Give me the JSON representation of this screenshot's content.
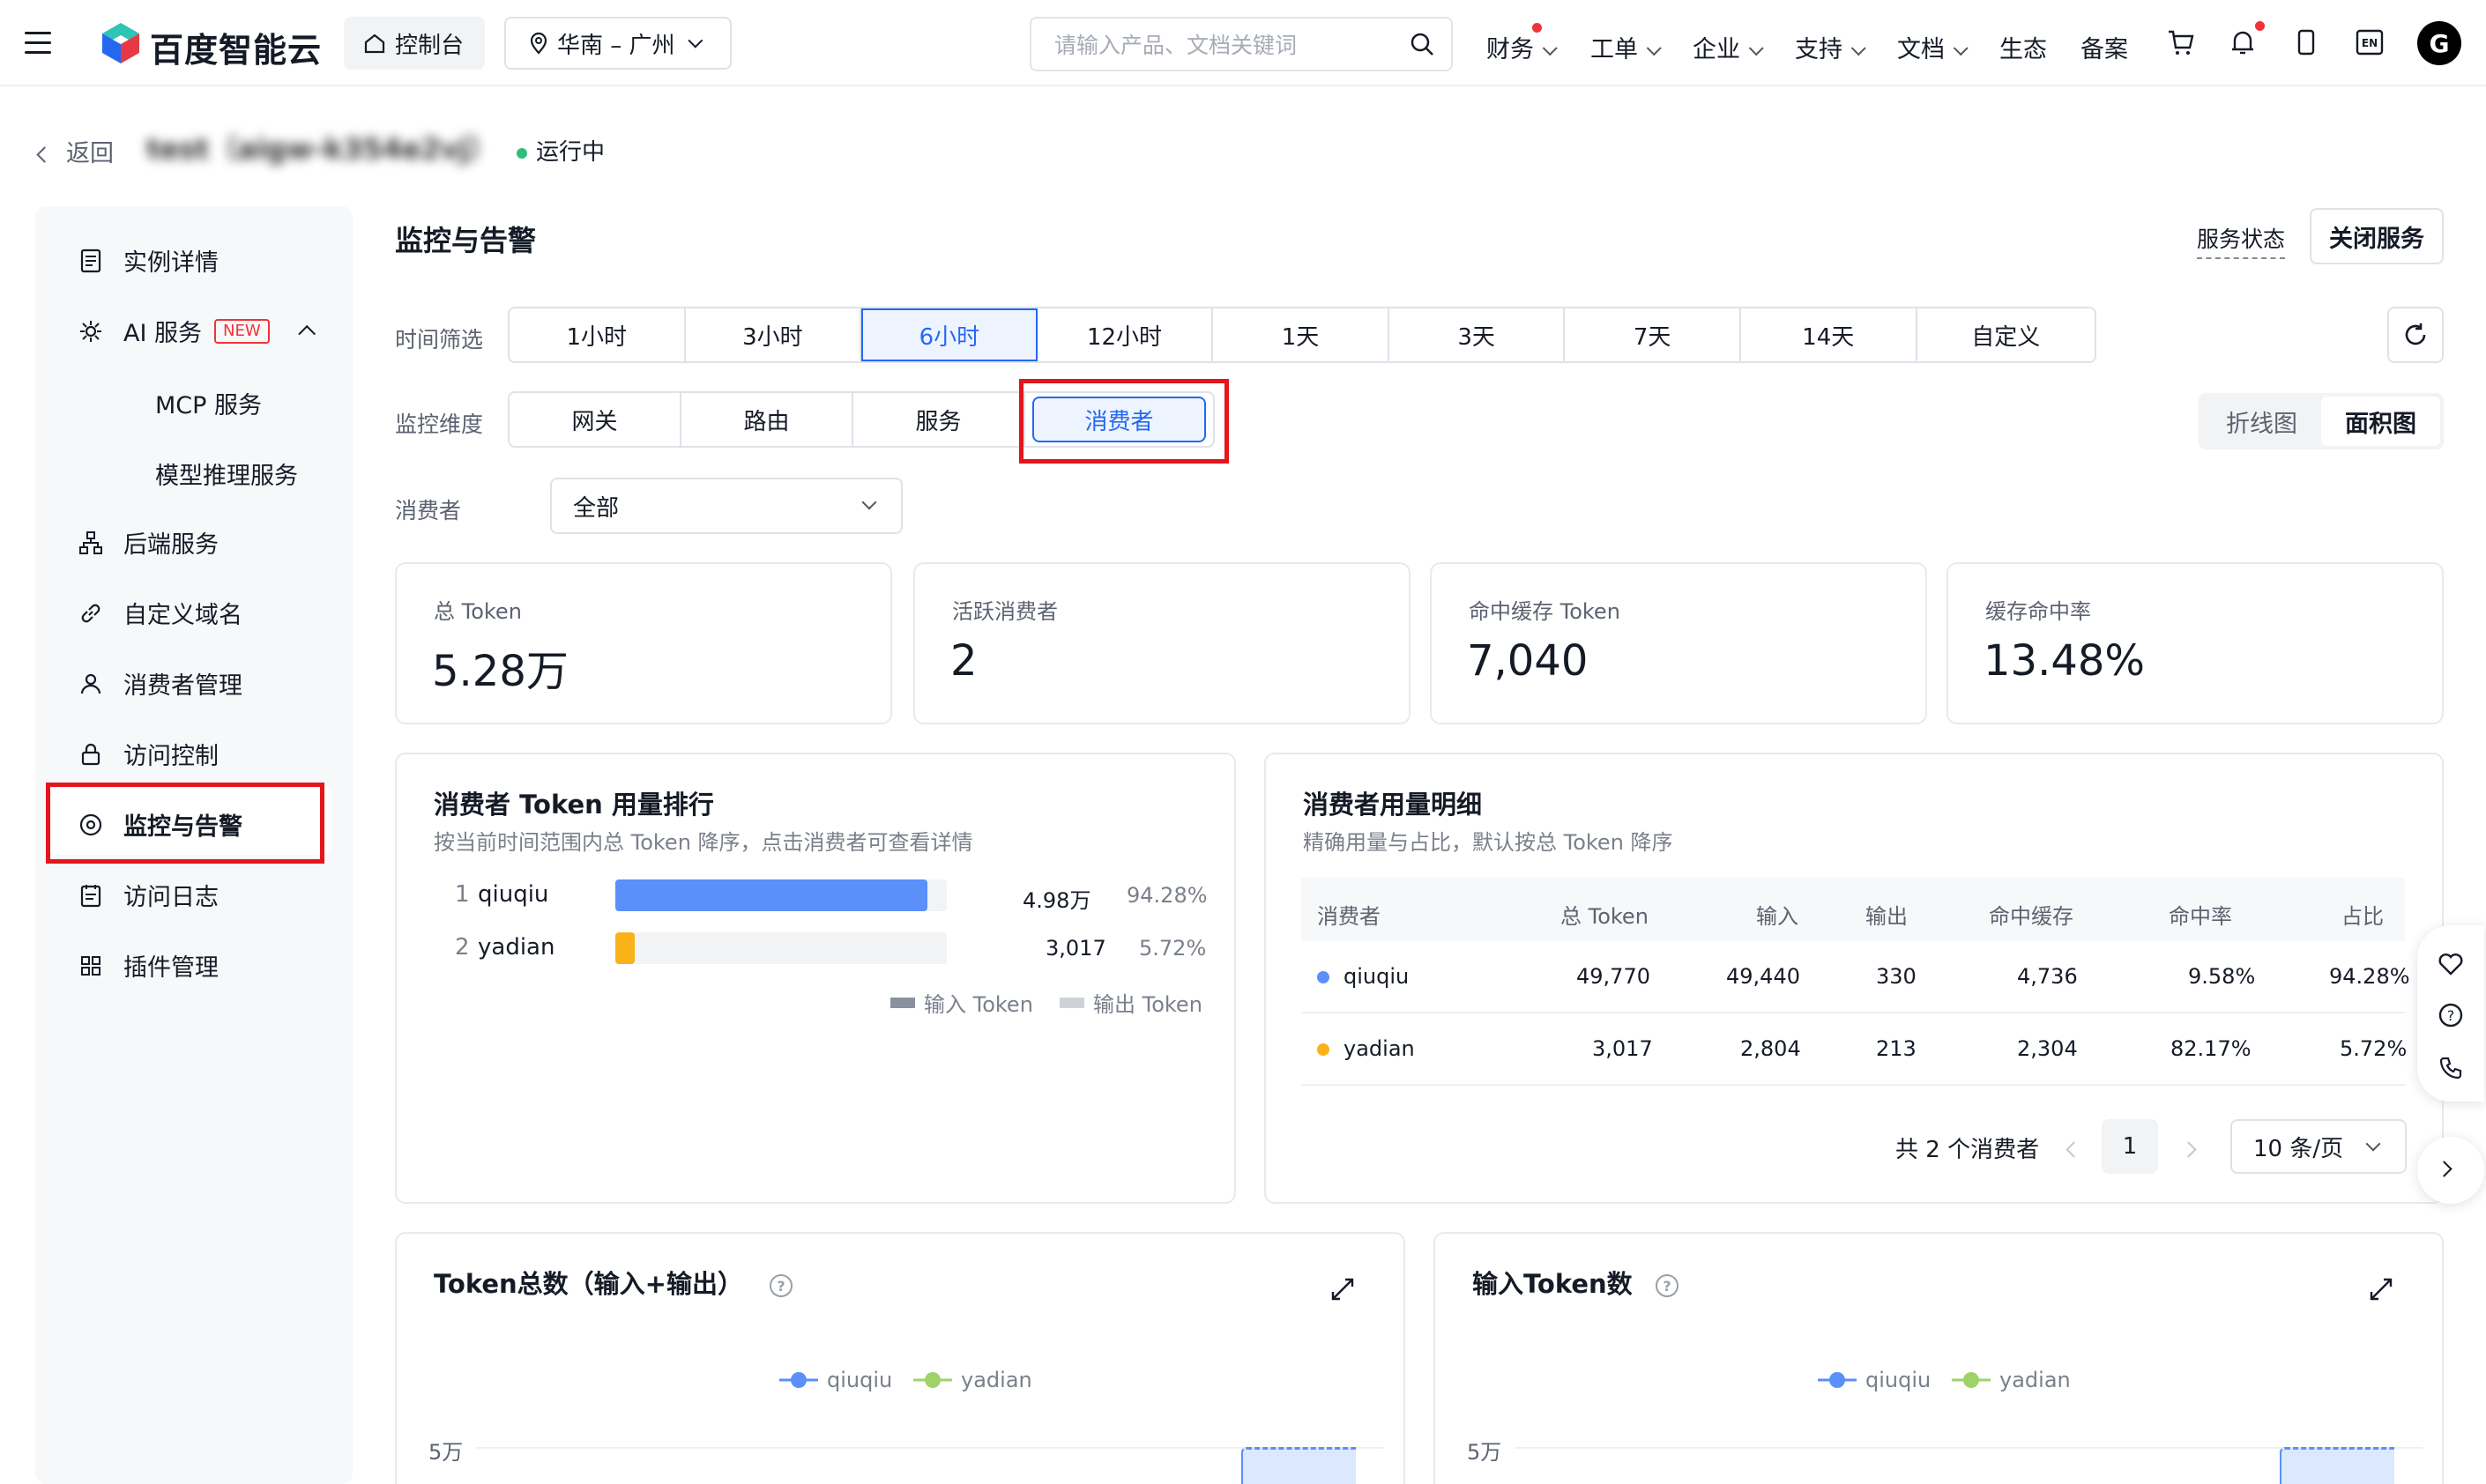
{
  "topbar": {
    "brand": "百度智能云",
    "console": "控制台",
    "region": "华南 – 广州",
    "search_placeholder": "请输入产品、文档关键词",
    "nav": [
      "财务",
      "工单",
      "企业",
      "支持",
      "文档",
      "生态",
      "备案"
    ],
    "avatar_letter": "G",
    "icons": [
      "cart-icon",
      "bell-icon",
      "mobile-icon",
      "en-icon"
    ]
  },
  "breadcrumb": {
    "back": "返回",
    "instance": "test（aigw-k354e2vj）",
    "status": "运行中"
  },
  "sidebar": {
    "items": [
      {
        "label": "实例详情"
      },
      {
        "label": "AI 服务",
        "badge": "NEW"
      },
      {
        "label": "MCP 服务",
        "sub": true
      },
      {
        "label": "模型推理服务",
        "sub": true
      },
      {
        "label": "后端服务"
      },
      {
        "label": "自定义域名"
      },
      {
        "label": "消费者管理"
      },
      {
        "label": "访问控制"
      },
      {
        "label": "监控与告警",
        "active": true
      },
      {
        "label": "访问日志"
      },
      {
        "label": "插件管理"
      }
    ]
  },
  "main": {
    "title": "监控与告警",
    "service_status": "服务状态",
    "close_service": "关闭服务",
    "time_filter_label": "时间筛选",
    "time_options": [
      "1小时",
      "3小时",
      "6小时",
      "12小时",
      "1天",
      "3天",
      "7天",
      "14天",
      "自定义"
    ],
    "time_selected": "6小时",
    "dimension_label": "监控维度",
    "dimension_options": [
      "网关",
      "路由",
      "服务",
      "消费者"
    ],
    "dimension_selected": "消费者",
    "chart_types": [
      "折线图",
      "面积图"
    ],
    "chart_type_selected": "面积图",
    "consumer_label": "消费者",
    "consumer_value": "全部"
  },
  "stats": [
    {
      "label": "总 Token",
      "value": "5.28万"
    },
    {
      "label": "活跃消费者",
      "value": "2"
    },
    {
      "label": "命中缓存 Token",
      "value": "7,040"
    },
    {
      "label": "缓存命中率",
      "value": "13.48%"
    }
  ],
  "ranking": {
    "title": "消费者 Token 用量排行",
    "subtitle": "按当前时间范围内总 Token 降序，点击消费者可查看详情",
    "rows": [
      {
        "idx": "1",
        "name": "qiuqiu",
        "value": "4.98万",
        "pct": "94.28%",
        "fraction": 0.9428,
        "color": "#5b8ff9"
      },
      {
        "idx": "2",
        "name": "yadian",
        "value": "3,017",
        "pct": "5.72%",
        "fraction": 0.0572,
        "color": "#fab219"
      }
    ],
    "legend": [
      "输入 Token",
      "输出 Token"
    ]
  },
  "detail": {
    "title": "消费者用量明细",
    "subtitle": "精确用量与占比，默认按总 Token 降序",
    "headers": [
      "消费者",
      "总 Token",
      "输入",
      "输出",
      "命中缓存",
      "命中率",
      "占比"
    ],
    "rows": [
      {
        "name": "qiuqiu",
        "color": "#5b8ff9",
        "total": "49,770",
        "input": "49,440",
        "output": "330",
        "cache": "4,736",
        "rate": "9.58%",
        "share": "94.28%"
      },
      {
        "name": "yadian",
        "color": "#fab219",
        "total": "3,017",
        "input": "2,804",
        "output": "213",
        "cache": "2,304",
        "rate": "82.17%",
        "share": "5.72%"
      }
    ],
    "total_text": "共 2 个消费者",
    "page": "1",
    "page_size": "10 条/页"
  },
  "charts": [
    {
      "title": "Token总数（输入+输出）",
      "legend": [
        "qiuqiu",
        "yadian"
      ],
      "ytick": "5万"
    },
    {
      "title": "输入Token数",
      "legend": [
        "qiuqiu",
        "yadian"
      ],
      "ytick": "5万"
    }
  ],
  "chart_colors": {
    "qiuqiu": "#5b8ff9",
    "yadian": "#9fd36a"
  }
}
